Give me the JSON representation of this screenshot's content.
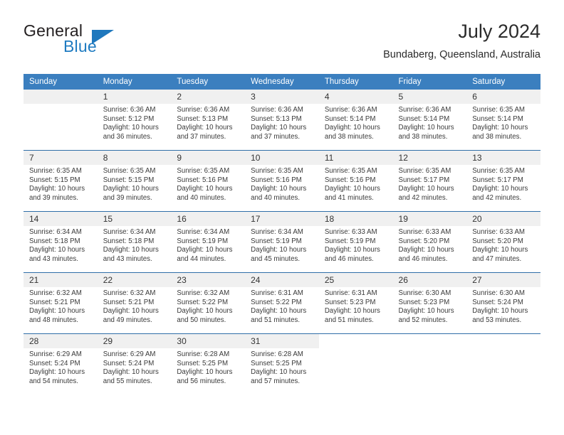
{
  "brand": {
    "name_primary": "General",
    "name_secondary": "Blue",
    "triangle_icon": "triangle-icon",
    "primary_color": "#231f20",
    "accent_color": "#1f7bc1"
  },
  "header": {
    "title": "July 2024",
    "subtitle": "Bundaberg, Queensland, Australia"
  },
  "theme": {
    "header_bg": "#3b7fbf",
    "header_text": "#ffffff",
    "daynum_bg": "#f0f0f0",
    "separator": "#2f6ea8"
  },
  "weekday_headers": [
    "Sunday",
    "Monday",
    "Tuesday",
    "Wednesday",
    "Thursday",
    "Friday",
    "Saturday"
  ],
  "labels": {
    "sunrise_prefix": "Sunrise:",
    "sunset_prefix": "Sunset:",
    "daylight_prefix": "Daylight:"
  },
  "weeks": [
    {
      "days": [
        {
          "num": "",
          "l1": "",
          "l2": "",
          "l3": "",
          "l4": ""
        },
        {
          "num": "1",
          "l1": "Sunrise: 6:36 AM",
          "l2": "Sunset: 5:12 PM",
          "l3": "Daylight: 10 hours",
          "l4": "and 36 minutes."
        },
        {
          "num": "2",
          "l1": "Sunrise: 6:36 AM",
          "l2": "Sunset: 5:13 PM",
          "l3": "Daylight: 10 hours",
          "l4": "and 37 minutes."
        },
        {
          "num": "3",
          "l1": "Sunrise: 6:36 AM",
          "l2": "Sunset: 5:13 PM",
          "l3": "Daylight: 10 hours",
          "l4": "and 37 minutes."
        },
        {
          "num": "4",
          "l1": "Sunrise: 6:36 AM",
          "l2": "Sunset: 5:14 PM",
          "l3": "Daylight: 10 hours",
          "l4": "and 38 minutes."
        },
        {
          "num": "5",
          "l1": "Sunrise: 6:36 AM",
          "l2": "Sunset: 5:14 PM",
          "l3": "Daylight: 10 hours",
          "l4": "and 38 minutes."
        },
        {
          "num": "6",
          "l1": "Sunrise: 6:35 AM",
          "l2": "Sunset: 5:14 PM",
          "l3": "Daylight: 10 hours",
          "l4": "and 38 minutes."
        }
      ]
    },
    {
      "days": [
        {
          "num": "7",
          "l1": "Sunrise: 6:35 AM",
          "l2": "Sunset: 5:15 PM",
          "l3": "Daylight: 10 hours",
          "l4": "and 39 minutes."
        },
        {
          "num": "8",
          "l1": "Sunrise: 6:35 AM",
          "l2": "Sunset: 5:15 PM",
          "l3": "Daylight: 10 hours",
          "l4": "and 39 minutes."
        },
        {
          "num": "9",
          "l1": "Sunrise: 6:35 AM",
          "l2": "Sunset: 5:16 PM",
          "l3": "Daylight: 10 hours",
          "l4": "and 40 minutes."
        },
        {
          "num": "10",
          "l1": "Sunrise: 6:35 AM",
          "l2": "Sunset: 5:16 PM",
          "l3": "Daylight: 10 hours",
          "l4": "and 40 minutes."
        },
        {
          "num": "11",
          "l1": "Sunrise: 6:35 AM",
          "l2": "Sunset: 5:16 PM",
          "l3": "Daylight: 10 hours",
          "l4": "and 41 minutes."
        },
        {
          "num": "12",
          "l1": "Sunrise: 6:35 AM",
          "l2": "Sunset: 5:17 PM",
          "l3": "Daylight: 10 hours",
          "l4": "and 42 minutes."
        },
        {
          "num": "13",
          "l1": "Sunrise: 6:35 AM",
          "l2": "Sunset: 5:17 PM",
          "l3": "Daylight: 10 hours",
          "l4": "and 42 minutes."
        }
      ]
    },
    {
      "days": [
        {
          "num": "14",
          "l1": "Sunrise: 6:34 AM",
          "l2": "Sunset: 5:18 PM",
          "l3": "Daylight: 10 hours",
          "l4": "and 43 minutes."
        },
        {
          "num": "15",
          "l1": "Sunrise: 6:34 AM",
          "l2": "Sunset: 5:18 PM",
          "l3": "Daylight: 10 hours",
          "l4": "and 43 minutes."
        },
        {
          "num": "16",
          "l1": "Sunrise: 6:34 AM",
          "l2": "Sunset: 5:19 PM",
          "l3": "Daylight: 10 hours",
          "l4": "and 44 minutes."
        },
        {
          "num": "17",
          "l1": "Sunrise: 6:34 AM",
          "l2": "Sunset: 5:19 PM",
          "l3": "Daylight: 10 hours",
          "l4": "and 45 minutes."
        },
        {
          "num": "18",
          "l1": "Sunrise: 6:33 AM",
          "l2": "Sunset: 5:19 PM",
          "l3": "Daylight: 10 hours",
          "l4": "and 46 minutes."
        },
        {
          "num": "19",
          "l1": "Sunrise: 6:33 AM",
          "l2": "Sunset: 5:20 PM",
          "l3": "Daylight: 10 hours",
          "l4": "and 46 minutes."
        },
        {
          "num": "20",
          "l1": "Sunrise: 6:33 AM",
          "l2": "Sunset: 5:20 PM",
          "l3": "Daylight: 10 hours",
          "l4": "and 47 minutes."
        }
      ]
    },
    {
      "days": [
        {
          "num": "21",
          "l1": "Sunrise: 6:32 AM",
          "l2": "Sunset: 5:21 PM",
          "l3": "Daylight: 10 hours",
          "l4": "and 48 minutes."
        },
        {
          "num": "22",
          "l1": "Sunrise: 6:32 AM",
          "l2": "Sunset: 5:21 PM",
          "l3": "Daylight: 10 hours",
          "l4": "and 49 minutes."
        },
        {
          "num": "23",
          "l1": "Sunrise: 6:32 AM",
          "l2": "Sunset: 5:22 PM",
          "l3": "Daylight: 10 hours",
          "l4": "and 50 minutes."
        },
        {
          "num": "24",
          "l1": "Sunrise: 6:31 AM",
          "l2": "Sunset: 5:22 PM",
          "l3": "Daylight: 10 hours",
          "l4": "and 51 minutes."
        },
        {
          "num": "25",
          "l1": "Sunrise: 6:31 AM",
          "l2": "Sunset: 5:23 PM",
          "l3": "Daylight: 10 hours",
          "l4": "and 51 minutes."
        },
        {
          "num": "26",
          "l1": "Sunrise: 6:30 AM",
          "l2": "Sunset: 5:23 PM",
          "l3": "Daylight: 10 hours",
          "l4": "and 52 minutes."
        },
        {
          "num": "27",
          "l1": "Sunrise: 6:30 AM",
          "l2": "Sunset: 5:24 PM",
          "l3": "Daylight: 10 hours",
          "l4": "and 53 minutes."
        }
      ]
    },
    {
      "days": [
        {
          "num": "28",
          "l1": "Sunrise: 6:29 AM",
          "l2": "Sunset: 5:24 PM",
          "l3": "Daylight: 10 hours",
          "l4": "and 54 minutes."
        },
        {
          "num": "29",
          "l1": "Sunrise: 6:29 AM",
          "l2": "Sunset: 5:24 PM",
          "l3": "Daylight: 10 hours",
          "l4": "and 55 minutes."
        },
        {
          "num": "30",
          "l1": "Sunrise: 6:28 AM",
          "l2": "Sunset: 5:25 PM",
          "l3": "Daylight: 10 hours",
          "l4": "and 56 minutes."
        },
        {
          "num": "31",
          "l1": "Sunrise: 6:28 AM",
          "l2": "Sunset: 5:25 PM",
          "l3": "Daylight: 10 hours",
          "l4": "and 57 minutes."
        },
        {
          "num": "",
          "l1": "",
          "l2": "",
          "l3": "",
          "l4": ""
        },
        {
          "num": "",
          "l1": "",
          "l2": "",
          "l3": "",
          "l4": ""
        },
        {
          "num": "",
          "l1": "",
          "l2": "",
          "l3": "",
          "l4": ""
        }
      ]
    }
  ]
}
